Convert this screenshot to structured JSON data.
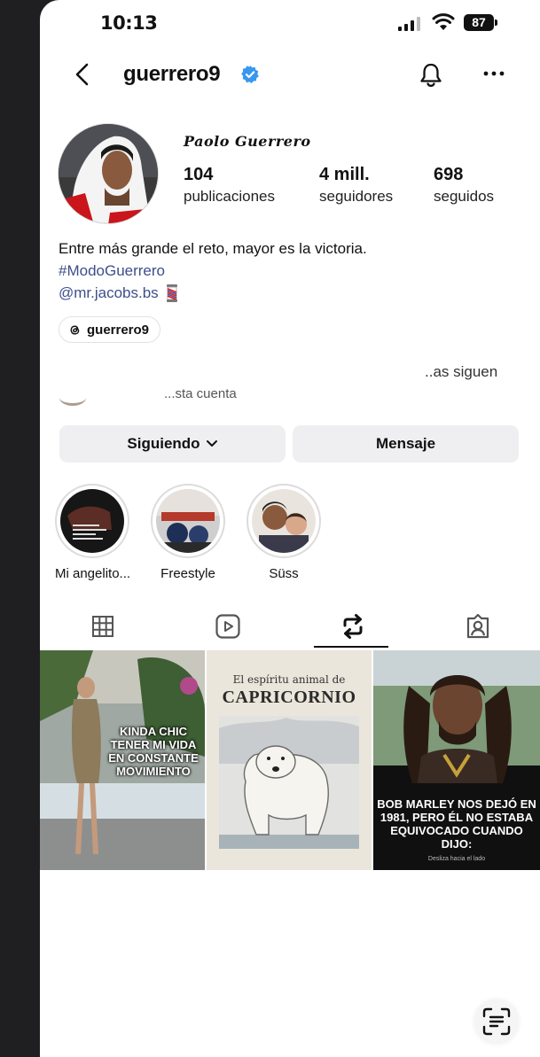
{
  "status": {
    "time": "10:13",
    "battery": "87"
  },
  "header": {
    "username": "guerrero9"
  },
  "profile": {
    "display_name": "Paolo Guerrero",
    "stats": [
      {
        "value": "104",
        "label": "publicaciones"
      },
      {
        "value": "4 mill.",
        "label": "seguidores"
      },
      {
        "value": "698",
        "label": "seguidos"
      }
    ],
    "bio_line": "Entre más grande el reto, mayor es la victoria.",
    "hashtag": "#ModoGuerrero",
    "mention": "@mr.jacobs.bs",
    "threads_handle": "guerrero9",
    "followed_by": "..as siguen",
    "followed_by_cut": "...sta cuenta"
  },
  "actions": {
    "following": "Siguiendo",
    "message": "Mensaje"
  },
  "highlights": [
    {
      "label": "Mi angelito..."
    },
    {
      "label": "Freestyle"
    },
    {
      "label": "Süss"
    }
  ],
  "tabs": [
    "grid-icon",
    "reels-icon",
    "reposts-icon",
    "tagged-icon"
  ],
  "posts": [
    {
      "caption": "KINDA CHIC TENER MI VIDA EN CONSTANTE MOVIMIENTO"
    },
    {
      "kicker": "El espíritu animal de",
      "caption": "CAPRICORNIO"
    },
    {
      "caption": "BOB MARLEY NOS DEJÓ EN 1981, PERO ÉL NO ESTABA EQUIVOCADO CUANDO DIJO:",
      "footer": "Desliza hacia el lado"
    }
  ],
  "colors": {
    "link": "#3d4e8c",
    "verified": "#3897f0",
    "button_bg": "#efeff1"
  }
}
